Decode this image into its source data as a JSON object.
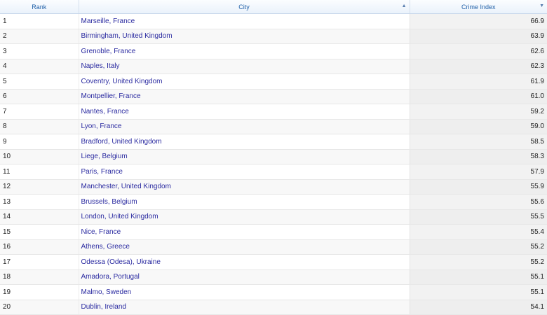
{
  "table": {
    "columns": {
      "rank": "Rank",
      "city": "City",
      "index": "Crime Index"
    },
    "rows": [
      {
        "rank": "1",
        "city": "Marseille, France",
        "index": "66.9"
      },
      {
        "rank": "2",
        "city": "Birmingham, United Kingdom",
        "index": "63.9"
      },
      {
        "rank": "3",
        "city": "Grenoble, France",
        "index": "62.6"
      },
      {
        "rank": "4",
        "city": "Naples, Italy",
        "index": "62.3"
      },
      {
        "rank": "5",
        "city": "Coventry, United Kingdom",
        "index": "61.9"
      },
      {
        "rank": "6",
        "city": "Montpellier, France",
        "index": "61.0"
      },
      {
        "rank": "7",
        "city": "Nantes, France",
        "index": "59.2"
      },
      {
        "rank": "8",
        "city": "Lyon, France",
        "index": "59.0"
      },
      {
        "rank": "9",
        "city": "Bradford, United Kingdom",
        "index": "58.5"
      },
      {
        "rank": "10",
        "city": "Liege, Belgium",
        "index": "58.3"
      },
      {
        "rank": "11",
        "city": "Paris, France",
        "index": "57.9"
      },
      {
        "rank": "12",
        "city": "Manchester, United Kingdom",
        "index": "55.9"
      },
      {
        "rank": "13",
        "city": "Brussels, Belgium",
        "index": "55.6"
      },
      {
        "rank": "14",
        "city": "London, United Kingdom",
        "index": "55.5"
      },
      {
        "rank": "15",
        "city": "Nice, France",
        "index": "55.4"
      },
      {
        "rank": "16",
        "city": "Athens, Greece",
        "index": "55.2"
      },
      {
        "rank": "17",
        "city": "Odessa (Odesa), Ukraine",
        "index": "55.2"
      },
      {
        "rank": "18",
        "city": "Amadora, Portugal",
        "index": "55.1"
      },
      {
        "rank": "19",
        "city": "Malmo, Sweden",
        "index": "55.1"
      },
      {
        "rank": "20",
        "city": "Dublin, Ireland",
        "index": "54.1"
      }
    ]
  },
  "icons": {
    "city_sort": "sort-ascending-icon",
    "index_sort": "sort-descending-icon"
  }
}
